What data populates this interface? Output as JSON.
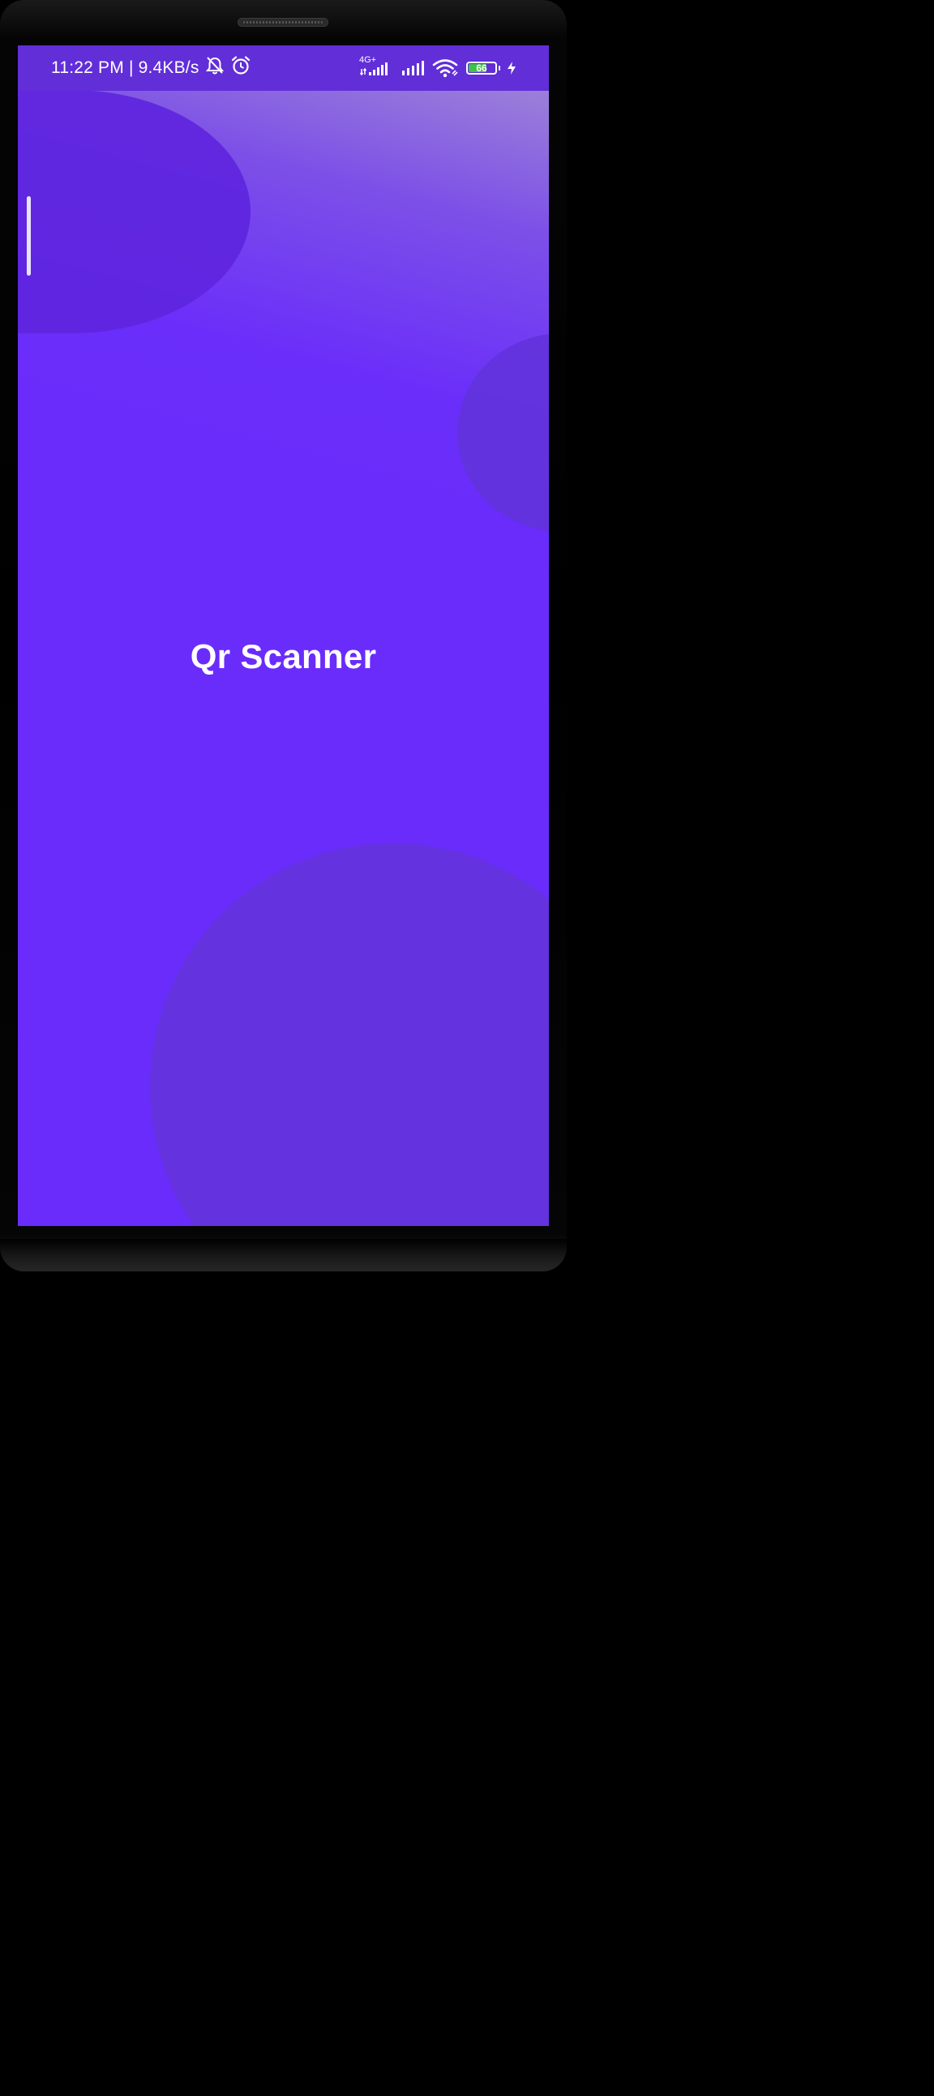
{
  "status_bar": {
    "time": "11:22 PM",
    "separator": "|",
    "network_speed": "9.4KB/s",
    "network_type": "4G+",
    "battery_level": "66",
    "battery_fraction": 0.66,
    "icons": [
      "bell-off-icon",
      "alarm-icon",
      "signal-icon",
      "signal-icon",
      "wifi-icon",
      "battery-icon",
      "charging-icon"
    ]
  },
  "app": {
    "title": "Qr Scanner"
  },
  "colors": {
    "background": "#6a2cfb",
    "status_bar": "#612ed8",
    "blob": "#6233dc",
    "text": "#ffffff",
    "battery_fill": "#3fc24a"
  }
}
